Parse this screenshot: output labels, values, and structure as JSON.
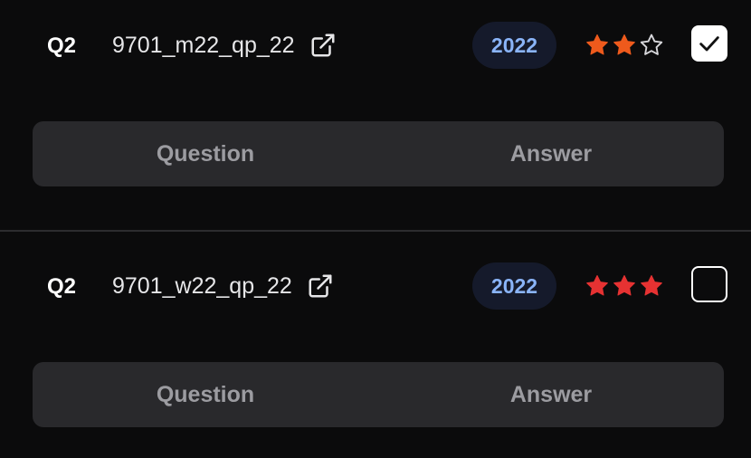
{
  "colors": {
    "background": "#0b0b0c",
    "tabs_background": "#29292c",
    "badge_background": "#151a2b",
    "badge_text": "#8ab4f8",
    "star_medium": "#ee5a1c",
    "star_hard": "#e63232",
    "star_empty_outline": "#d8d8dc"
  },
  "questions": [
    {
      "number": "Q2",
      "paper": "9701_m22_qp_22",
      "link_icon": "external-link-icon",
      "year": "2022",
      "difficulty": 2,
      "difficulty_max": 3,
      "checked": true,
      "tabs": [
        "Question",
        "Answer"
      ]
    },
    {
      "number": "Q2",
      "paper": "9701_w22_qp_22",
      "link_icon": "external-link-icon",
      "year": "2022",
      "difficulty": 3,
      "difficulty_max": 3,
      "checked": false,
      "tabs": [
        "Question",
        "Answer"
      ]
    }
  ]
}
